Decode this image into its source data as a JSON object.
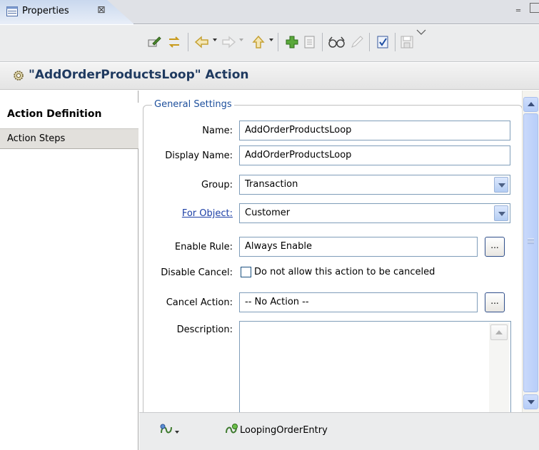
{
  "view": {
    "tab_title": "Properties",
    "tab_close_symbol": "⊠",
    "minimize_symbol": "‗"
  },
  "toolbar": {
    "icons": [
      "edit-icon",
      "sync-icon",
      "back-icon",
      "forward-icon",
      "up-icon",
      "add-icon",
      "copy-icon",
      "view-icon",
      "pencil-icon",
      "validate-icon",
      "save-icon",
      "view-menu-icon"
    ]
  },
  "header": {
    "icon": "gear-icon",
    "title": "\"AddOrderProductsLoop\" Action"
  },
  "nav": {
    "items": [
      {
        "label": "Action Definition",
        "selected": true
      },
      {
        "label": "Action Steps",
        "selected": false
      }
    ]
  },
  "form": {
    "group_title": "General Settings",
    "name_label": "Name:",
    "name_value": "AddOrderProductsLoop",
    "display_name_label": "Display Name:",
    "display_name_value": "AddOrderProductsLoop",
    "group_label": "Group:",
    "group_value": "Transaction",
    "for_object_label": "For Object:",
    "for_object_value": "Customer",
    "enable_rule_label": "Enable Rule:",
    "enable_rule_value": "Always Enable",
    "disable_cancel_label": "Disable Cancel:",
    "disable_cancel_checkbox_label": "Do not allow this action to be canceled",
    "disable_cancel_checked": false,
    "cancel_action_label": "Cancel Action:",
    "cancel_action_value": "-- No Action --",
    "description_label": "Description:",
    "description_value": "",
    "ellipsis": "..."
  },
  "statusbar": {
    "label": "LoopingOrderEntry"
  },
  "colors": {
    "header_title": "#1f3a60",
    "group_title": "#1d4f9c",
    "link": "#1c3fa6",
    "scrollbar": "#b8cef9"
  }
}
